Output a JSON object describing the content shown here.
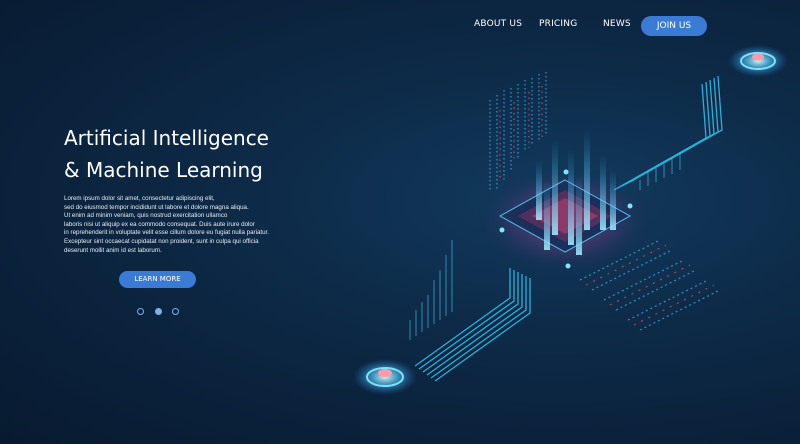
{
  "nav": {
    "links": [
      "ABOUT US",
      "PRICING",
      "NEWS"
    ],
    "join_label": "JOIN US"
  },
  "hero": {
    "title_line1": "Artificial Intelligence",
    "title_line2": "& Machine Learning",
    "body_lines": [
      "Lorem ipsum dolor sit amet, consectetur adipiscing elit,",
      "sed do eiusmod tempor incididunt ut labore et dolore magna aliqua.",
      "Ut enim ad minim veniam, quis nostrud exercitation ullamco",
      "laboris nisi ut aliquip ex ea commodo consequat. Duis aute irure dolor",
      "in reprehenderit in voluptate velit esse cillum dolore eu fugiat nulla pariatur.",
      "Excepteur sint occaecat cupidatat non proident, sunt in culpa qui officia",
      "deserunt mollit anim id est laborum."
    ],
    "cta_label": "LEARN MORE"
  },
  "carousel": {
    "active_index": 1,
    "count": 3
  },
  "colors": {
    "accent": "#3a7bd5",
    "background": "#0d2a47",
    "glow": "#27c4f5",
    "highlight": "#ff4f7a"
  },
  "illustration": {
    "icon": "ai-chip-circuit-illustration"
  }
}
